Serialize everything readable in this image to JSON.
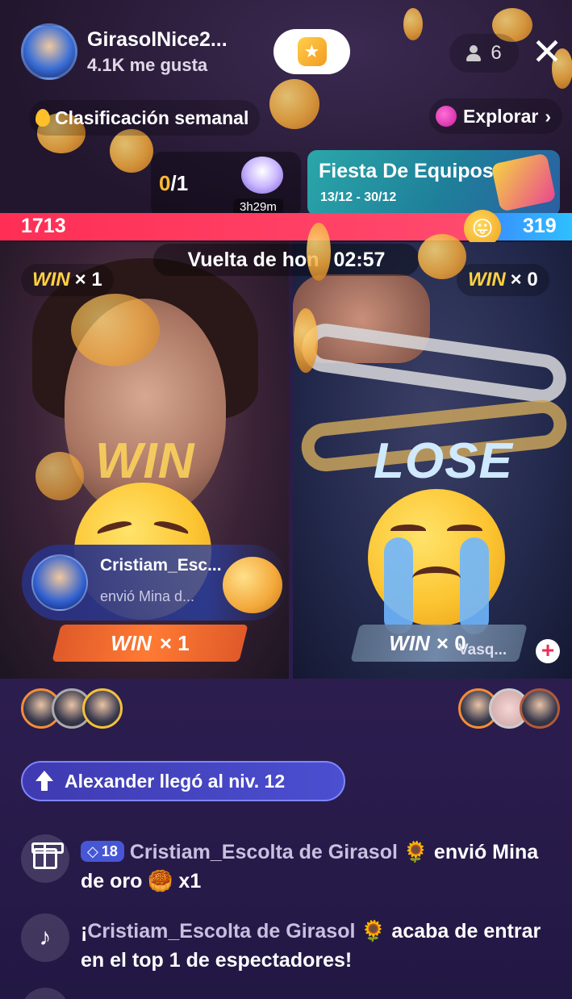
{
  "host": {
    "name": "GirasolNice2...",
    "likes": "4.1K me gusta"
  },
  "header": {
    "viewer_count": "6",
    "close_symbol": "✕",
    "follow_icon": "star-icon"
  },
  "ranking": {
    "label": "Clasificación semanal"
  },
  "explore": {
    "label": "Explorar",
    "chevron": "›"
  },
  "match": {
    "current": "0",
    "total": "/1",
    "gift_timer": "3h29m"
  },
  "event": {
    "title": "Fiesta De Equipos",
    "dates": "13/12 - 30/12"
  },
  "pk": {
    "left_score": "1713",
    "right_score": "319",
    "left_share": 0.843,
    "round_label": "Vuelta de hon",
    "countdown": "02:57",
    "colors": {
      "left": "#ff2e55",
      "right": "#3a8bff"
    }
  },
  "left_panel": {
    "win_label": "WIN",
    "win_count": "× 1",
    "result": "WIN",
    "gift_sender": "Cristiam_Esc...",
    "gift_desc": "envió Mina d...",
    "banner_win": "WIN",
    "banner_count": "× 1"
  },
  "right_panel": {
    "win_label": "WIN",
    "win_count": "× 0",
    "result": "LOSE",
    "banner_win": "WIN",
    "banner_count": "× 0",
    "opponent": "Vasq...",
    "add_symbol": "+"
  },
  "level_up": {
    "text": "Alexander llegó al niv. 12"
  },
  "chat": [
    {
      "icon": "gift-icon",
      "badge": "18",
      "user": "Cristiam_Escolta de Girasol 🌻",
      "text": " envió Mina de oro 🥮  x1"
    },
    {
      "icon": "tiktok-icon",
      "prefix": "¡",
      "user": "Cristiam_Escolta de Girasol 🌻",
      "text": " acaba de entrar en el top 1 de espectadores!"
    }
  ]
}
